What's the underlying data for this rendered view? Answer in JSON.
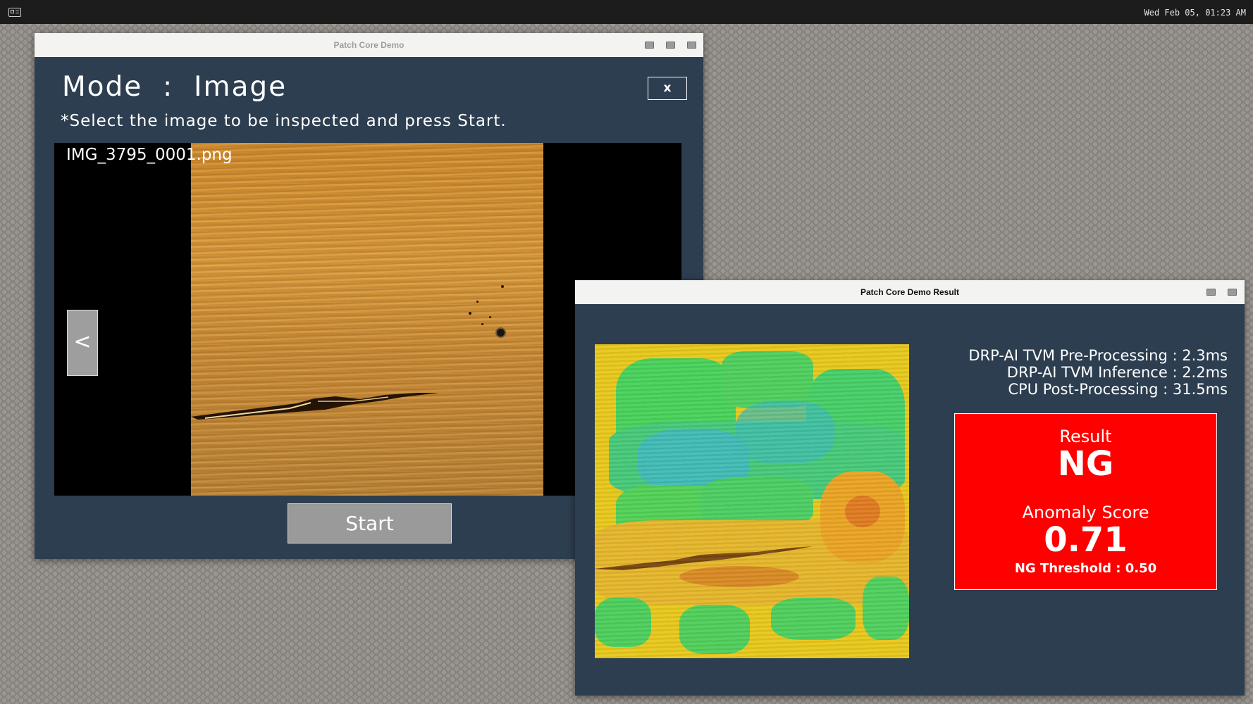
{
  "topbar": {
    "launcher_icon": "window-switcher-icon",
    "clock": "Wed Feb 05, 01:23 AM"
  },
  "main_window": {
    "title": "Patch Core Demo",
    "mode_title": "Mode  :  Image",
    "instruction": "*Select the image to be inspected and press Start.",
    "close_label": "x",
    "filename": "IMG_3795_0001.png",
    "prev_label": "<",
    "start_label": "Start",
    "background_color": "#2c3e50"
  },
  "result_window": {
    "title": "Patch Core Demo Result",
    "timings": [
      "DRP-AI TVM Pre-Processing : 2.3ms",
      "DRP-AI TVM Inference : 2.2ms",
      "CPU Post-Processing : 31.5ms"
    ],
    "result_label": "Result",
    "result_value": "NG",
    "score_label": "Anomaly Score",
    "score_value": "0.71",
    "threshold": "NG Threshold : 0.50",
    "result_color": "#ff0000"
  }
}
